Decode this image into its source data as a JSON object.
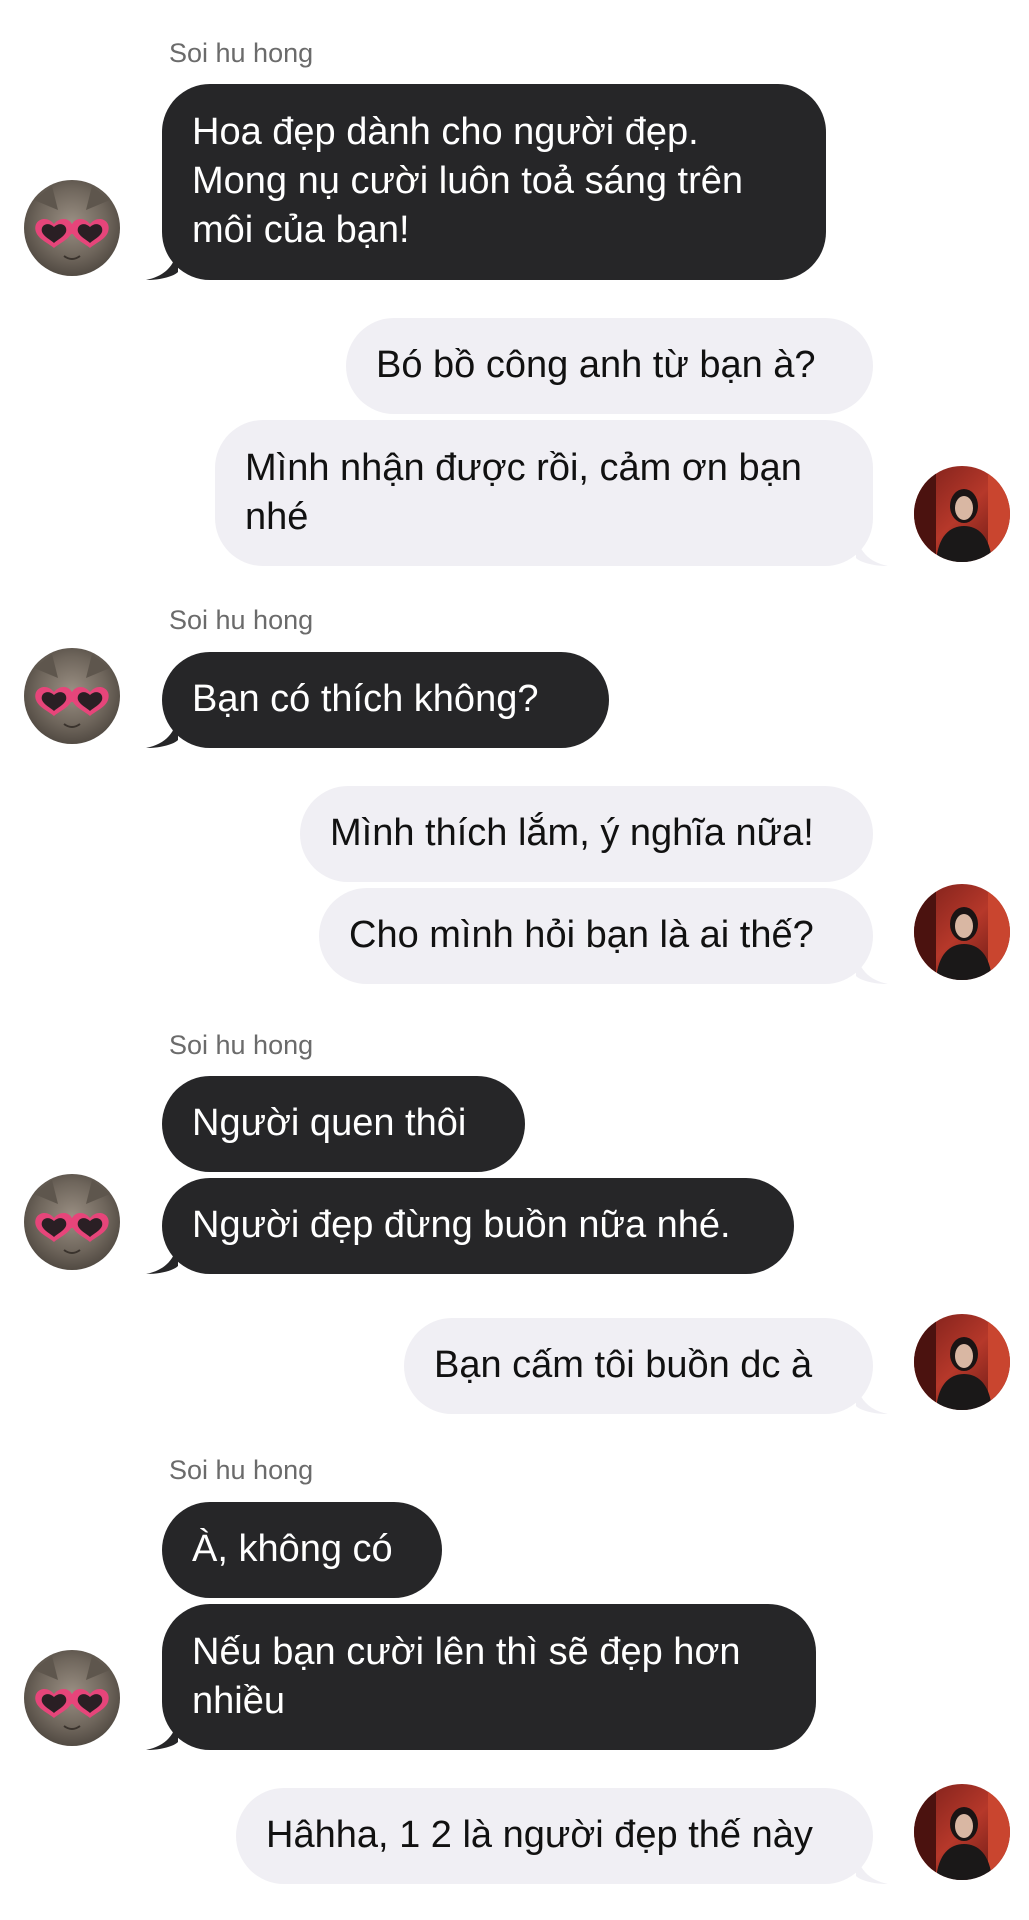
{
  "contact": {
    "name": "Soi hu hong"
  },
  "messages": [
    {
      "from": "them",
      "text": "Hoa đẹp dành cho người đẹp. Mong nụ cười luôn toả sáng trên môi của bạn!"
    },
    {
      "from": "me",
      "text": "Bó bồ công anh từ bạn à?"
    },
    {
      "from": "me",
      "text": "Mình nhận được rồi, cảm ơn bạn nhé"
    },
    {
      "from": "them",
      "text": "Bạn có thích không?"
    },
    {
      "from": "me",
      "text": "Mình thích lắm, ý nghĩa nữa!"
    },
    {
      "from": "me",
      "text": "Cho mình hỏi bạn là ai thế?"
    },
    {
      "from": "them",
      "text": "Người quen thôi"
    },
    {
      "from": "them",
      "text": "Người đẹp đừng buồn nữa nhé."
    },
    {
      "from": "me",
      "text": "Bạn cấm tôi buồn dc à"
    },
    {
      "from": "them",
      "text": "À, không có"
    },
    {
      "from": "them",
      "text": "Nếu bạn cười lên thì sẽ đẹp hơn nhiều"
    },
    {
      "from": "me",
      "text": "Hâhha, 1 2 là người đẹp thế này"
    }
  ],
  "icons": {
    "contact_avatar": "cat-with-heart-sunglasses-avatar",
    "my_avatar": "user-photo-avatar"
  },
  "colors": {
    "incoming_bubble": "#262628",
    "outgoing_bubble": "#f0eff4",
    "incoming_text": "#ffffff",
    "outgoing_text": "#111111",
    "sender_name": "#6b6b6b"
  }
}
